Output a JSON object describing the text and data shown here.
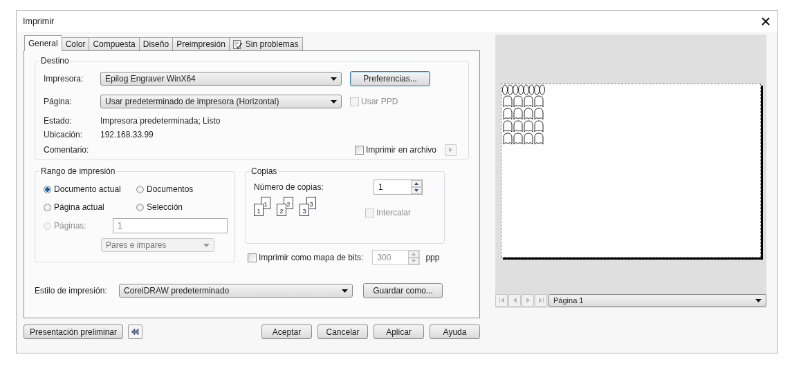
{
  "window": {
    "title": "Imprimir"
  },
  "tabs": [
    {
      "label": "General",
      "selected": true,
      "kind": "text"
    },
    {
      "label": "Color",
      "selected": false,
      "kind": "text"
    },
    {
      "label": "Compuesta",
      "selected": false,
      "kind": "text"
    },
    {
      "label": "Diseño",
      "selected": false,
      "kind": "text"
    },
    {
      "label": "Preimpresión",
      "selected": false,
      "kind": "text"
    },
    {
      "label": "Sin problemas",
      "selected": false,
      "kind": "icon"
    }
  ],
  "destination": {
    "title": "Destino",
    "printer": {
      "label": "Impresora:",
      "value": "Epilog Engraver WinX64"
    },
    "preferences_button": "Preferencias...",
    "page": {
      "label": "Página:",
      "value": "Usar predeterminado de impresora (Horizontal)"
    },
    "use_ppd": {
      "label": "Usar PPD",
      "checked": false,
      "disabled": true
    },
    "status": {
      "label": "Estado:",
      "value": "Impresora predeterminada; Listo"
    },
    "location": {
      "label": "Ubicación:",
      "value": "192.168.33.99"
    },
    "comment": {
      "label": "Comentario:"
    },
    "print_to_file": {
      "label": "Imprimir en archivo",
      "checked": false
    }
  },
  "print_range": {
    "title": "Rango de impresión",
    "options": [
      {
        "label": "Documento actual",
        "selected": true,
        "disabled": false
      },
      {
        "label": "Documentos",
        "selected": false,
        "disabled": false
      },
      {
        "label": "Página actual",
        "selected": false,
        "disabled": false
      },
      {
        "label": "Selección",
        "selected": false,
        "disabled": false
      },
      {
        "label": "Páginas:",
        "selected": false,
        "disabled": true
      }
    ],
    "pages_value": "1",
    "parity": "Pares e impares"
  },
  "copies": {
    "title": "Copias",
    "label": "Número de copias:",
    "value": "1",
    "collate_pages": [
      {
        "back": "1",
        "front": "1"
      },
      {
        "back": "2",
        "front": "2"
      },
      {
        "back": "3",
        "front": "3"
      }
    ],
    "collate": {
      "label": "Intercalar",
      "checked": false,
      "disabled": true
    }
  },
  "bitmap": {
    "label": "Imprimir como mapa de bits:",
    "checked": false,
    "value": "300",
    "unit": "ppp"
  },
  "style": {
    "label": "Estilo de impresión:",
    "value": "CorelDRAW predeterminado",
    "save_button": "Guardar como..."
  },
  "preview": {
    "page_selector": "Página 1"
  },
  "buttons": {
    "preview": "Presentación preliminar",
    "actions": [
      "Aceptar",
      "Cancelar",
      "Aplicar",
      "Ayuda"
    ]
  }
}
